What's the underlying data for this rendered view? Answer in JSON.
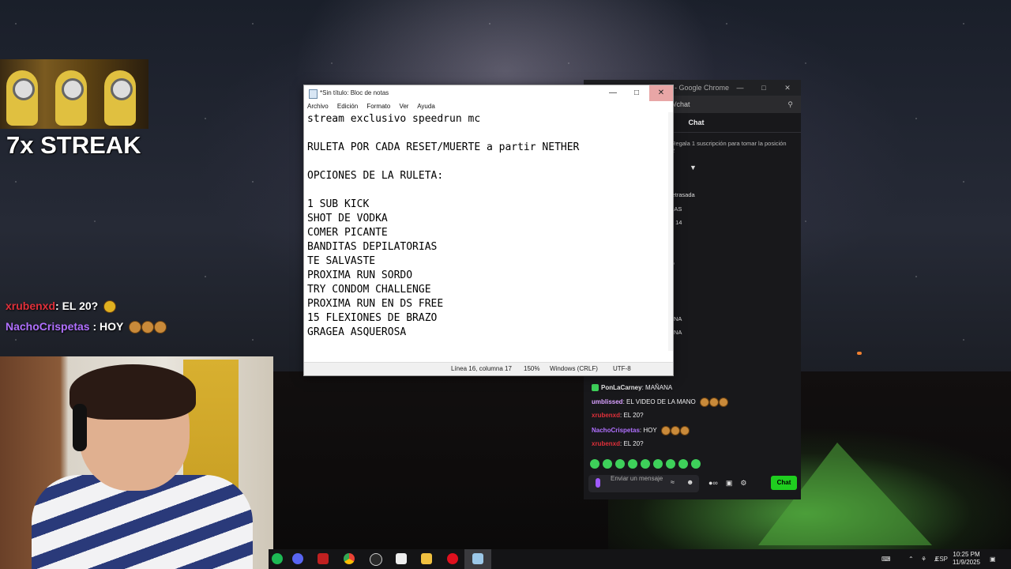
{
  "overlay": {
    "streak": "7x STREAK",
    "chat": [
      {
        "user": "xrubenxd",
        "sep": ": ",
        "text": "EL 20?"
      },
      {
        "user": "NachoCrispetas",
        "sep": " : ",
        "text": "HOY"
      }
    ]
  },
  "notepad": {
    "title": "*Sin título: Bloc de notas",
    "menu": [
      "Archivo",
      "Edición",
      "Formato",
      "Ver",
      "Ayuda"
    ],
    "lines": [
      "stream exclusivo speedrun mc",
      "",
      "RULETA POR CADA RESET/MUERTE a partir NETHER",
      "",
      "OPCIONES DE LA RULETA:",
      "",
      "1 SUB KICK",
      "SHOT DE VODKA",
      "COMER PICANTE",
      "BANDITAS DEPILATORIAS",
      "TE SALVASTE",
      "PROXIMA RUN SORDO",
      "TRY CONDOM CHALLENGE",
      "PROXIMA RUN EN DS FREE",
      "15 FLEXIONES DE BRAZO",
      "GRAGEA ASQUEROSA"
    ],
    "status": {
      "position": "Línea 16, columna 17",
      "zoom": "150%",
      "eol": "Windows (CRLF)",
      "encoding": "UTF-8"
    }
  },
  "chrome": {
    "title": "t - Google Chrome",
    "url": "o/chat",
    "chat_header": "Chat",
    "pinned": "Regala 1 suscripción para tomar la posición 2",
    "fragments": [
      "retrasada",
      "NAS",
      "S 14",
      "N",
      "O",
      "ANA",
      "ANA"
    ],
    "messages": [
      {
        "user": "PonLaCarney",
        "text": ": MAÑANA"
      },
      {
        "user": "umblissed",
        "text": ": EL VIDEO DE LA MANO"
      },
      {
        "user": "xrubenxd",
        "text": ": EL 20?"
      },
      {
        "user": "NachoCrispetas",
        "text": ": HOY"
      },
      {
        "user": "xrubenxd",
        "text": ": EL 20?"
      }
    ],
    "input_placeholder": "Enviar un mensaje",
    "chat_button": "Chat"
  },
  "taskbar": {
    "language": "ESP",
    "time": "10:25 PM",
    "date": "11/9/2025"
  },
  "colors": {
    "twitch_purple": "#b070ff",
    "chat_green": "#1fce1f",
    "user_red": "#e0303a"
  }
}
